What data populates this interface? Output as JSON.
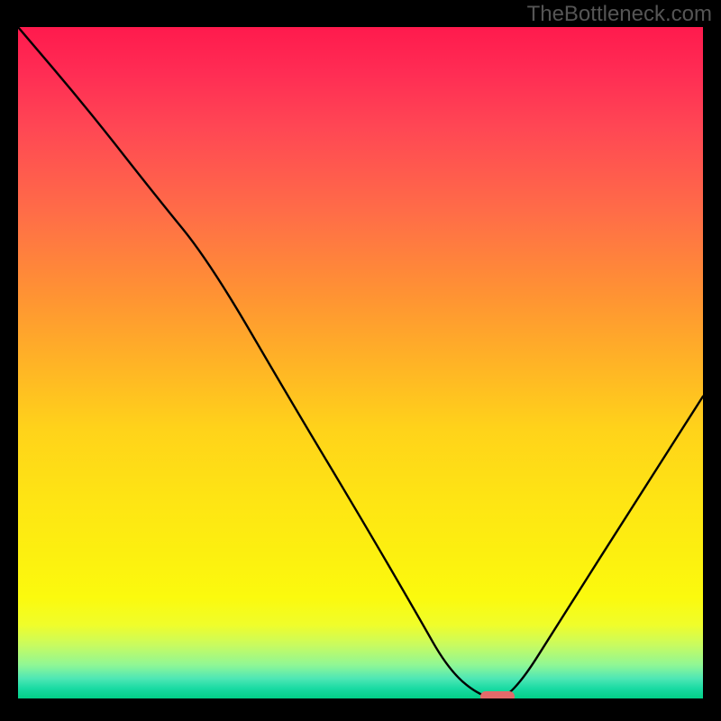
{
  "watermark": "TheBottleneck.com",
  "chart_data": {
    "type": "line",
    "title": "",
    "xlabel": "",
    "ylabel": "",
    "xlim": [
      0,
      100
    ],
    "ylim": [
      0,
      100
    ],
    "background": {
      "type": "vertical-gradient",
      "stops": [
        {
          "pos": 0,
          "color": "#ff1a4d"
        },
        {
          "pos": 50,
          "color": "#ffb326"
        },
        {
          "pos": 85,
          "color": "#fbfa0e"
        },
        {
          "pos": 100,
          "color": "#02d087"
        }
      ]
    },
    "series": [
      {
        "name": "bottleneck-curve",
        "x": [
          0,
          10,
          20,
          28,
          40,
          50,
          58,
          63,
          68,
          72,
          80,
          90,
          100
        ],
        "y": [
          100,
          88,
          75,
          65,
          44,
          27,
          13,
          4,
          0,
          0,
          13,
          29,
          45
        ]
      }
    ],
    "marker": {
      "name": "optimal-point",
      "x": 70,
      "y": 0,
      "width": 5,
      "height": 1.6,
      "color": "#e36a6a"
    },
    "grid": false,
    "legend": false
  }
}
